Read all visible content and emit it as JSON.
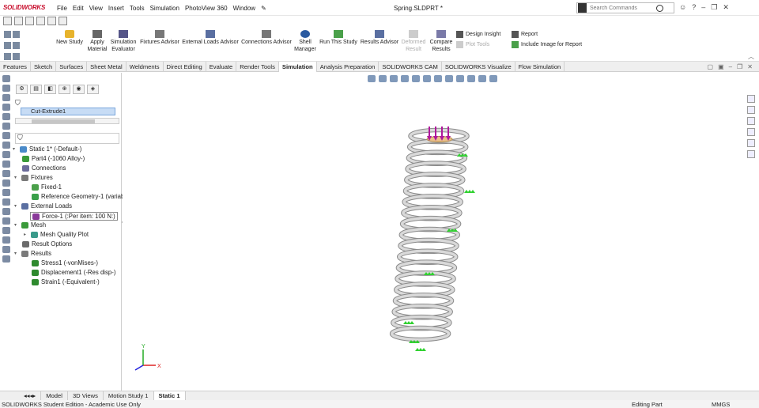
{
  "app": {
    "logo": "SOLIDWORKS",
    "document_title": "Spring.SLDPRT *"
  },
  "menus": [
    "File",
    "Edit",
    "View",
    "Insert",
    "Tools",
    "Simulation",
    "PhotoView 360",
    "Window"
  ],
  "search": {
    "placeholder": "Search Commands"
  },
  "commands": {
    "new_study": "New Study",
    "apply_material": "Apply Material",
    "simulation_evaluator": "Simulation Evaluator",
    "fixtures_advisor": "Fixtures Advisor",
    "external_loads_advisor": "External Loads Advisor",
    "connections_advisor": "Connections Advisor",
    "shell_manager": "Shell Manager",
    "run_this_study": "Run This Study",
    "results_advisor": "Results Advisor",
    "deformed_result": "Deformed Result",
    "compare_results": "Compare Results",
    "design_insight": "Design Insight",
    "plot_tools": "Plot Tools",
    "report": "Report",
    "include_image": "Include Image for Report"
  },
  "tabs": [
    "Features",
    "Sketch",
    "Surfaces",
    "Sheet Metal",
    "Weldments",
    "Direct Editing",
    "Evaluate",
    "Render Tools",
    "Simulation",
    "Analysis Preparation",
    "SOLIDWORKS CAM",
    "SOLIDWORKS Visualize",
    "Flow Simulation"
  ],
  "active_tab": "Simulation",
  "tree": {
    "selected_feature": "Cut-Extrude1",
    "items": [
      {
        "label": "Static 1* (-Default-)"
      },
      {
        "label": "Part4 (-1060 Alloy-)"
      },
      {
        "label": "Connections"
      },
      {
        "label": "Fixtures"
      },
      {
        "label": "Fixed-1"
      },
      {
        "label": "Reference Geometry-1 (variab"
      },
      {
        "label": "External Loads"
      },
      {
        "label": "Force-1 (:Per item: 100 N:)"
      },
      {
        "label": "Mesh"
      },
      {
        "label": "Mesh Quality Plot"
      },
      {
        "label": "Result Options"
      },
      {
        "label": "Results"
      },
      {
        "label": "Stress1 (-vonMises-)"
      },
      {
        "label": "Displacement1 (-Res disp-)"
      },
      {
        "label": "Strain1 (-Equivalent-)"
      }
    ]
  },
  "bottom_tabs": [
    "Model",
    "3D Views",
    "Motion Study 1",
    "Static 1"
  ],
  "status": {
    "left": "SOLIDWORKS Student Edition - Academic Use Only",
    "mode": "Editing Part",
    "units": "MMGS"
  },
  "axes": {
    "x": "X",
    "y": "Y"
  },
  "colors": {
    "accent": "#c8102e",
    "selection": "#c7dcf5",
    "fixture_green": "#2fd12f",
    "load_magenta": "#b0179c",
    "spring_gray": "#d9d9d9"
  }
}
